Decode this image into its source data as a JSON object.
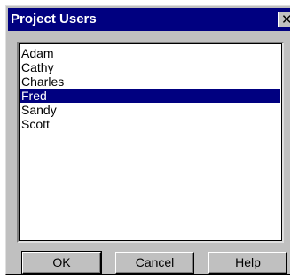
{
  "window": {
    "title": "Project Users",
    "close_label": "✕"
  },
  "users_list": {
    "items": [
      "Adam",
      "Cathy",
      "Charles",
      "Fred",
      "Sandy",
      "Scott"
    ],
    "selected_index": 3
  },
  "buttons": {
    "ok_label": "OK",
    "cancel_label": "Cancel",
    "help_first": "H",
    "help_rest": "elp"
  },
  "colors": {
    "titlebar": "#000080",
    "selection": "#000080",
    "face": "#c0c0c0"
  }
}
